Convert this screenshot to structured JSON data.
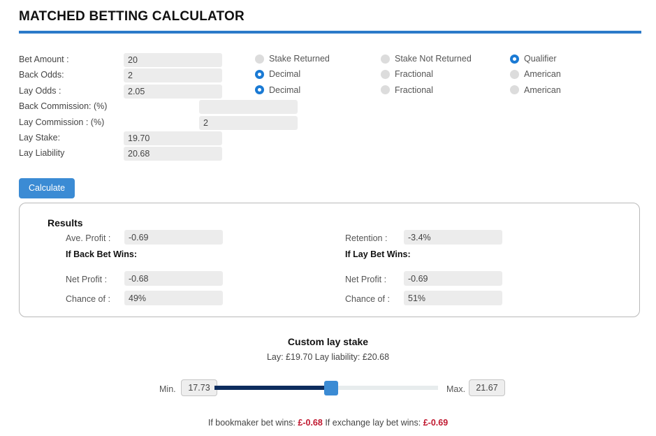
{
  "header": {
    "title": "MATCHED BETTING CALCULATOR",
    "rule_color": "#2c7ac9"
  },
  "form": {
    "rows": [
      {
        "label": "Bet Amount :",
        "value": "20",
        "input_placeholder": "",
        "radios": [
          {
            "label": "Stake Returned",
            "selected": false
          },
          {
            "label": "Stake Not Returned",
            "selected": false
          },
          {
            "label": "Qualifier",
            "selected": true
          }
        ]
      },
      {
        "label": "Back Odds:",
        "value": "2",
        "input_placeholder": "",
        "radios": [
          {
            "label": "Decimal",
            "selected": true
          },
          {
            "label": "Fractional",
            "selected": false
          },
          {
            "label": "American",
            "selected": false
          }
        ]
      },
      {
        "label": "Lay Odds :",
        "value": "2.05",
        "input_placeholder": "",
        "radios": [
          {
            "label": "Decimal",
            "selected": true
          },
          {
            "label": "Fractional",
            "selected": false
          },
          {
            "label": "American",
            "selected": false
          }
        ]
      }
    ],
    "back_commission": {
      "label": "Back Commission: (%)",
      "value": "",
      "placeholder": ""
    },
    "lay_commission": {
      "label": "Lay Commission : (%)",
      "value": "2",
      "placeholder": ""
    },
    "lay_stake": {
      "label": "Lay Stake:",
      "value": "19.70"
    },
    "lay_liability": {
      "label": "Lay Liability",
      "value": "20.68"
    },
    "calculate_label": "Calculate"
  },
  "results": {
    "title": "Results",
    "accent": "#3b8bd4",
    "left": {
      "ave_profit_label": "Ave. Profit :",
      "ave_profit_value": "-0.69",
      "section_label": "If Back Bet Wins:",
      "net_profit_label": "Net Profit :",
      "net_profit_value": "-0.68",
      "chance_label": "Chance of :",
      "chance_value": "49%"
    },
    "right": {
      "retention_label": "Retention :",
      "retention_value": "-3.4%",
      "section_label": "If Lay Bet Wins:",
      "net_profit_label": "Net Profit :",
      "net_profit_value": "-0.69",
      "chance_label": "Chance of :",
      "chance_value": "51%"
    }
  },
  "custom_lay_stake": {
    "title": "Custom lay stake",
    "subtitle": "Lay: £19.70 Lay liability: £20.68",
    "min_label": "Min.",
    "min_value": "17.73",
    "max_label": "Max.",
    "max_value": "21.67",
    "slider_percent": 52,
    "track_color": "#0d2d5e",
    "handle_color": "#3b8bd4"
  },
  "footer": {
    "bookmaker_prefix": "If bookmaker bet wins:",
    "bookmaker_amount": "£-0.68",
    "exchange_prefix": "If exchange lay bet wins:",
    "exchange_amount": "£-0.69",
    "amount_color": "#c0182f"
  }
}
